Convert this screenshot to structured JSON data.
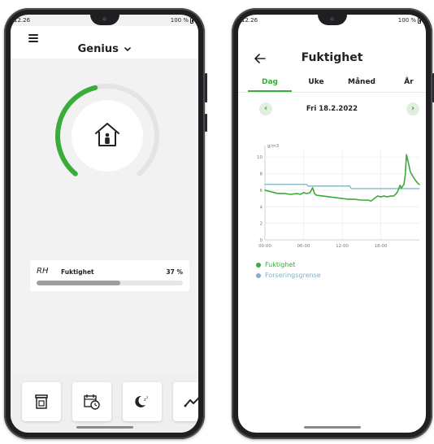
{
  "colors": {
    "accent": "#3aac3a",
    "limit_line": "#7fb2c2",
    "gauge_track": "#e4e4e4",
    "bar_fill": "#9e9e9e"
  },
  "left_phone": {
    "status": {
      "time": "12.26",
      "battery": "100 %"
    },
    "header": {
      "menu_icon": "hamburger-menu-icon",
      "title": "Genius",
      "title_chevron": "chevron-down-icon"
    },
    "gauge": {
      "level": 0.45,
      "icon": "house-person-icon"
    },
    "humidity_card": {
      "abbr": "RH",
      "label": "Fuktighet",
      "value": "37 %",
      "level": 0.57
    },
    "bottom_nav": [
      {
        "name": "fireplace-icon"
      },
      {
        "name": "calendar-clock-icon"
      },
      {
        "name": "moon-sleep-icon"
      },
      {
        "name": "trend-graph-icon"
      }
    ]
  },
  "right_phone": {
    "status": {
      "time": "12.26",
      "battery": "100 %"
    },
    "header": {
      "back_icon": "back-arrow-icon",
      "title": "Fuktighet"
    },
    "tabs": [
      {
        "label": "Dag",
        "active": true
      },
      {
        "label": "Uke",
        "active": false
      },
      {
        "label": "Måned",
        "active": false
      },
      {
        "label": "År",
        "active": false
      }
    ],
    "date_nav": {
      "prev": "‹",
      "date": "Fri 18.2.2022",
      "next": "›"
    },
    "legend": [
      {
        "label": "Fuktighet",
        "color": "#3aac3a"
      },
      {
        "label": "Forseringsgrense",
        "color": "#7fb2c2"
      }
    ]
  },
  "chart_data": {
    "type": "line",
    "ylabel": "g/m3",
    "ylim": [
      0,
      11
    ],
    "yticks": [
      0,
      2,
      4,
      6,
      8,
      10
    ],
    "xlim": [
      0,
      24
    ],
    "xticks": [
      {
        "value": 0,
        "label": "00:00"
      },
      {
        "value": 6,
        "label": "06:00"
      },
      {
        "value": 12,
        "label": "12:00"
      },
      {
        "value": 18,
        "label": "18:00"
      }
    ],
    "grid": true,
    "legend_position": "bottom-left",
    "series": [
      {
        "name": "Fuktighet",
        "color": "#3aac3a",
        "x": [
          0,
          0.5,
          1.0,
          1.5,
          2.0,
          3.0,
          4.0,
          5.0,
          5.5,
          6.0,
          6.5,
          7.0,
          7.4,
          7.7,
          8.0,
          9.0,
          10.0,
          11.0,
          12.0,
          13.0,
          14.0,
          15.0,
          16.0,
          16.5,
          17.0,
          17.5,
          18.0,
          18.5,
          19.0,
          19.5,
          20.0,
          20.3,
          20.6,
          21.0,
          21.2,
          21.4,
          21.6,
          21.8,
          22.0,
          22.3,
          22.6,
          22.9,
          23.2,
          23.5,
          23.8,
          24.0
        ],
        "y": [
          6.0,
          5.9,
          5.8,
          5.7,
          5.6,
          5.6,
          5.5,
          5.6,
          5.5,
          5.7,
          5.6,
          5.7,
          6.3,
          5.6,
          5.4,
          5.3,
          5.2,
          5.1,
          5.0,
          4.9,
          4.9,
          4.8,
          4.8,
          4.7,
          5.0,
          5.3,
          5.2,
          5.3,
          5.2,
          5.3,
          5.3,
          5.5,
          5.8,
          6.6,
          6.2,
          6.5,
          6.7,
          7.8,
          10.3,
          9.3,
          8.2,
          7.8,
          7.4,
          7.1,
          6.8,
          6.7
        ]
      },
      {
        "name": "Forseringsgrense",
        "color": "#7fb2c2",
        "x": [
          0,
          6.5,
          6.7,
          13.2,
          13.4,
          24
        ],
        "y": [
          6.7,
          6.7,
          6.5,
          6.5,
          6.2,
          6.2
        ]
      }
    ]
  }
}
